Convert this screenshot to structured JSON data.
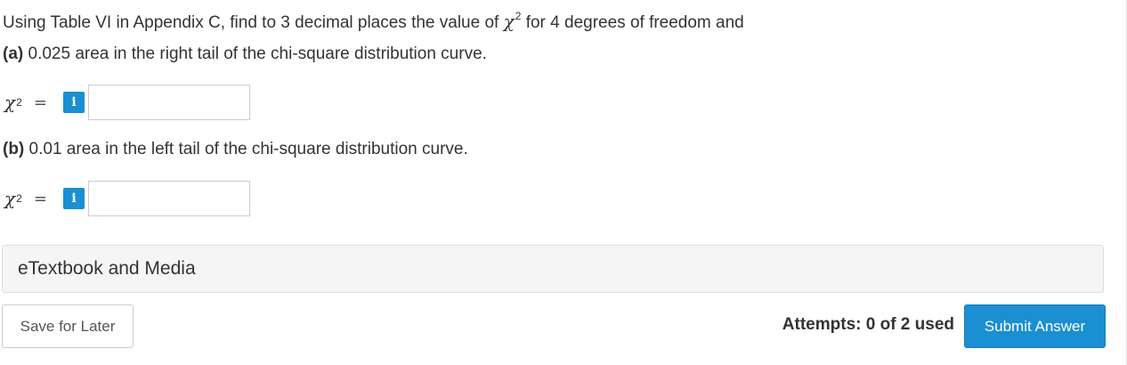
{
  "question": {
    "text_before": "Using Table VI in Appendix C, find to 3 decimal places the value of ",
    "symbol": "χ",
    "exponent": "2",
    "text_after": " for 4 degrees of freedom and"
  },
  "part_a": {
    "tag": "(a)",
    "text": " 0.025 area in the right tail of the chi-square distribution curve.",
    "symbol": "χ",
    "exponent": "2",
    "equals": "=",
    "info_icon": "i",
    "input_value": ""
  },
  "part_b": {
    "tag": "(b)",
    "text": " 0.01 area in the left tail of the chi-square distribution curve.",
    "symbol": "χ",
    "exponent": "2",
    "equals": "=",
    "info_icon": "i",
    "input_value": ""
  },
  "resources": {
    "label": "eTextbook and Media"
  },
  "footer": {
    "save_label": "Save for Later",
    "attempts_label": "Attempts: 0 of 2 used",
    "submit_label": "Submit Answer"
  },
  "colors": {
    "accent": "#1a8fd1",
    "text": "#333333",
    "panel_bg": "#f5f5f5",
    "border": "#cccccc"
  },
  "icons": {
    "info": "info-icon"
  }
}
